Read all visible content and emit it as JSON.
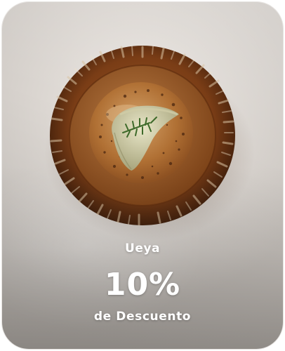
{
  "promo": {
    "brand": "Ueya",
    "discount": "10%",
    "subtitle": "de Descuento"
  },
  "colors": {
    "text": "#ffffff",
    "background": "#dcd7d2",
    "plate": "#8a4a1f",
    "sauce": "#b27a3c"
  },
  "image": {
    "subject": "dumpling-in-ceramic-bowl"
  }
}
